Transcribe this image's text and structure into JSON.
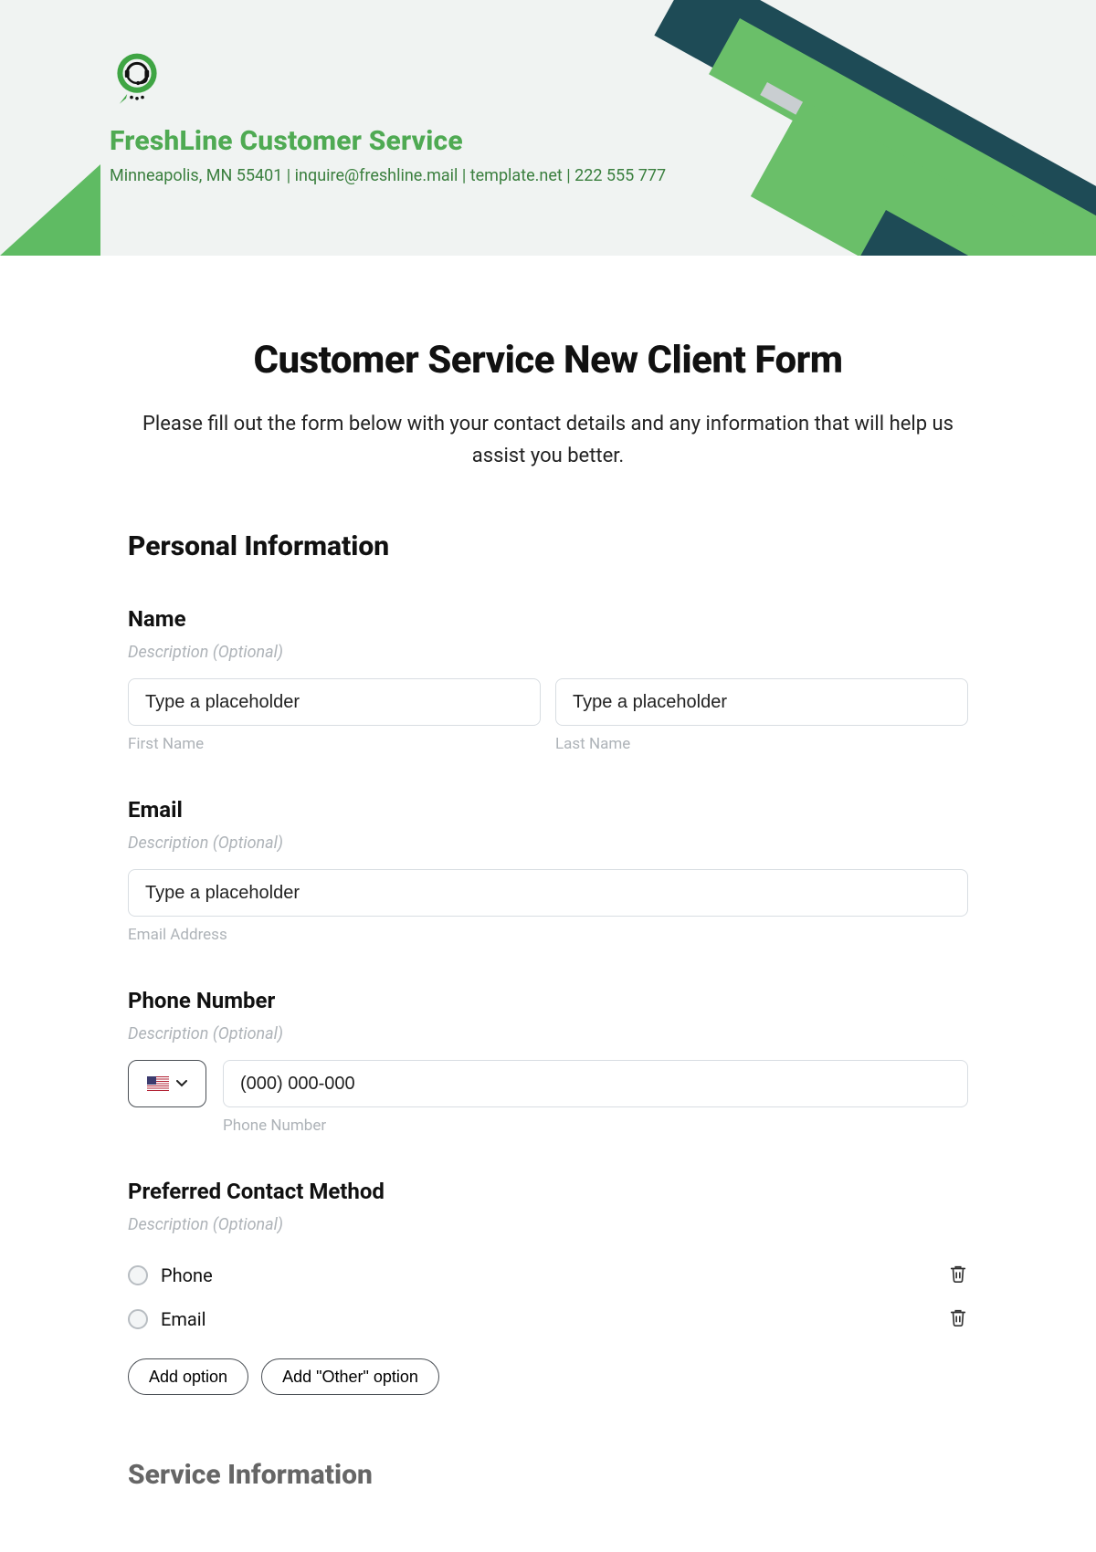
{
  "header": {
    "org_name": "FreshLine Customer Service",
    "contact_line": "Minneapolis, MN 55401 | inquire@freshline.mail | template.net | 222 555 777"
  },
  "form": {
    "title": "Customer Service New Client Form",
    "description": "Please fill out the form below with your contact details and any information that will help us assist you better."
  },
  "sections": {
    "personal": {
      "title": "Personal Information",
      "name": {
        "label": "Name",
        "desc": "Description (Optional)",
        "first_placeholder": "Type a placeholder",
        "first_sublabel": "First Name",
        "last_placeholder": "Type a placeholder",
        "last_sublabel": "Last Name"
      },
      "email": {
        "label": "Email",
        "desc": "Description (Optional)",
        "placeholder": "Type a placeholder",
        "sublabel": "Email Address"
      },
      "phone": {
        "label": "Phone Number",
        "desc": "Description (Optional)",
        "placeholder": "(000) 000-000",
        "sublabel": "Phone Number",
        "country": "US"
      },
      "contact_method": {
        "label": "Preferred Contact Method",
        "desc": "Description (Optional)",
        "options": [
          "Phone",
          "Email"
        ],
        "add_option_label": "Add option",
        "add_other_label": "Add \"Other\" option"
      }
    },
    "service": {
      "title": "Service Information"
    }
  }
}
